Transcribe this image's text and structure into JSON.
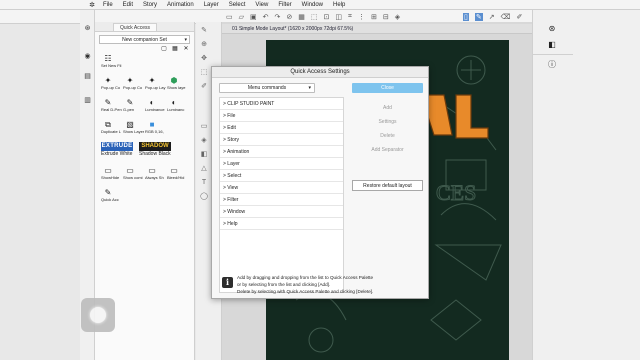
{
  "menubar": {
    "logo_glyph": "✲",
    "items": [
      "File",
      "Edit",
      "Story",
      "Animation",
      "Layer",
      "Select",
      "View",
      "Filter",
      "Window",
      "Help"
    ]
  },
  "quick_access": {
    "tab_label": "Quick Access",
    "set_name": "New companion Set",
    "chevron": "▾",
    "icon_row": [
      "▢",
      "▦",
      "✕"
    ],
    "items": [
      {
        "label": "Set New Fil",
        "icon": "☷"
      },
      {
        "label": "Pop-up Co",
        "icon": "✦"
      },
      {
        "label": "Pop-up Co",
        "icon": "✦"
      },
      {
        "label": "Pop-up Lay",
        "icon": "✦"
      },
      {
        "label": "Show laye",
        "icon": "⬢"
      },
      {
        "label": "Real D-Pen",
        "icon": "✎"
      },
      {
        "label": "G-pen",
        "icon": "✎"
      },
      {
        "label": "Luminance",
        "icon": "◐"
      },
      {
        "label": "Luminanc",
        "icon": "◐"
      },
      {
        "label": "Duplicate L",
        "icon": "⧉"
      },
      {
        "label": "Show Layer",
        "icon": "▧"
      },
      {
        "label": "RGB 0,16,",
        "icon": "■"
      },
      {
        "label": "Extrude White",
        "icon": "EXTRUDE"
      },
      {
        "label": "Shadow Black",
        "icon": "SHADOW"
      },
      {
        "label": "ShowHide",
        "icon": "▭"
      },
      {
        "label": "Show comi",
        "icon": "▭"
      },
      {
        "label": "Always Sh",
        "icon": "▭"
      },
      {
        "label": "Bleed/Hid",
        "icon": "▭"
      },
      {
        "label": "Quick Acc",
        "icon": "✎"
      }
    ]
  },
  "canvas": {
    "tab_title": "01 Simple Mode Layout* (1620 x 2000px 72dpi 67.5%)"
  },
  "dialog": {
    "title": "Quick Access Settings",
    "dropdown_value": "Menu commands",
    "chevron": "▾",
    "commands": [
      "> CLIP STUDIO PAINT",
      "> File",
      "> Edit",
      "> Story",
      "> Animation",
      "> Layer",
      "> Select",
      "> View",
      "> Filter",
      "> Window",
      "> Help"
    ],
    "close_label": "Close",
    "add_label": "Add",
    "settings_label": "Settings",
    "delete_label": "Delete",
    "add_separator_label": "Add Separator",
    "restore_label": "Restore default layout",
    "info_lines": [
      "Add by dragging and dropping from the list to Quick Access Palette",
      "or by selecting from the list and clicking [Add].",
      "Delete by selecting with Quick Access Palette and clicking [Delete]."
    ]
  },
  "colors": {
    "close_button": "#7ec4ee",
    "artwork_bg": "#132a20",
    "title_orange": "#e88a2a"
  }
}
